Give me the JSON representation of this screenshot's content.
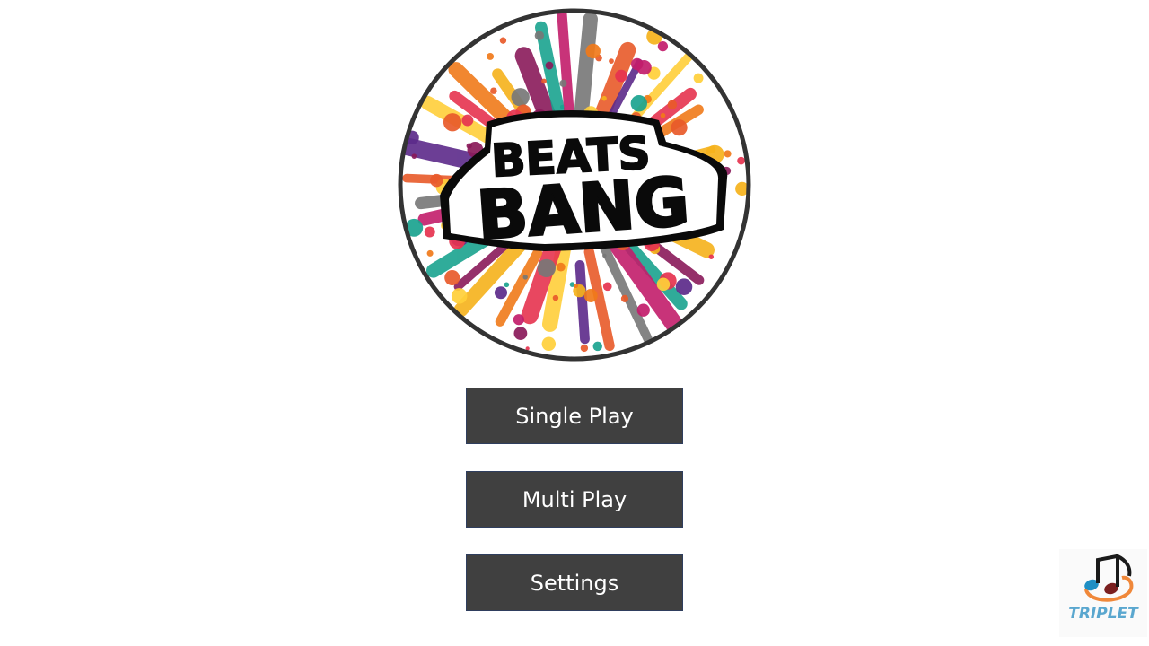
{
  "logo": {
    "line1": "BEATS",
    "line2": "BANG"
  },
  "menu": {
    "single_play": "Single Play",
    "multi_play": "Multi Play",
    "settings": "Settings"
  },
  "brand": {
    "name": "TRIPLET"
  },
  "colors": {
    "button_bg": "#404040",
    "button_text": "#ffffff",
    "logo_ring": "#333333",
    "brand_text": "#5aa7cf"
  }
}
